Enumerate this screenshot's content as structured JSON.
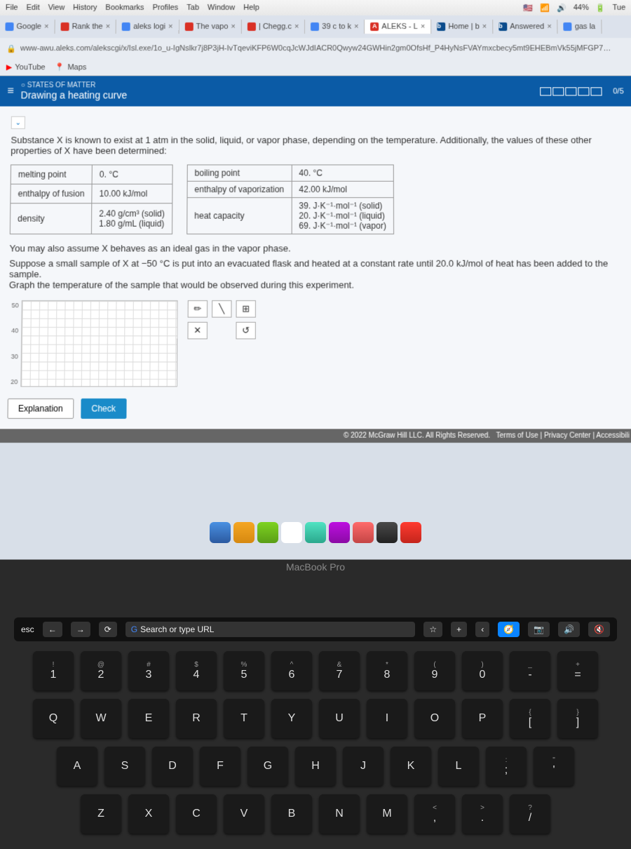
{
  "menubar": {
    "items": [
      "File",
      "Edit",
      "View",
      "History",
      "Bookmarks",
      "Profiles",
      "Tab",
      "Window",
      "Help"
    ],
    "battery": "44%",
    "day": "Tue"
  },
  "tabs": [
    {
      "label": "Google",
      "icon": "#4285f4"
    },
    {
      "label": "Rank the",
      "icon": "#d93025"
    },
    {
      "label": "aleks logi",
      "icon": "#4285f4"
    },
    {
      "label": "The vapo",
      "icon": "#d93025"
    },
    {
      "label": "| Chegg.c",
      "icon": "#d93025"
    },
    {
      "label": "39 c to k",
      "icon": "#4285f4"
    },
    {
      "label": "ALEKS - L",
      "icon": "#d93025",
      "active": true
    },
    {
      "label": "Home | b",
      "icon": "#0a4b8c"
    },
    {
      "label": "Answered",
      "icon": "#0a4b8c"
    },
    {
      "label": "gas la",
      "icon": "#4285f4"
    }
  ],
  "url": "www-awu.aleks.com/alekscgi/x/Isl.exe/1o_u-IgNslkr7j8P3jH-IvTqeviKFP6W0cqJcWJdIACR0Qwyw24GWHin2gm0OfsHf_P4HyNsFVAYmxcbecy5mt9EHEBmVk55jMFGP7…",
  "bookmarks": [
    {
      "label": "YouTube",
      "icon": "#ff0000"
    },
    {
      "label": "Maps",
      "icon": "#34a853"
    }
  ],
  "aleks": {
    "category": "STATES OF MATTER",
    "title": "Drawing a heating curve",
    "score": "0/5"
  },
  "problem": {
    "intro": "Substance X is known to exist at 1 atm in the solid, liquid, or vapor phase, depending on the temperature. Additionally, the values of these other properties of X have been determined:",
    "table1": {
      "r1c1": "melting point",
      "r1c2": "0. °C",
      "r2c1": "enthalpy of fusion",
      "r2c2": "10.00 kJ/mol",
      "r3c1": "density",
      "r3c2a": "2.40 g/cm³ (solid)",
      "r3c2b": "1.80 g/mL (liquid)"
    },
    "table2": {
      "r1c1": "boiling point",
      "r1c2": "40. °C",
      "r2c1": "enthalpy of vaporization",
      "r2c2": "42.00 kJ/mol",
      "r3c1": "heat capacity",
      "r3c2a": "39. J·K⁻¹·mol⁻¹ (solid)",
      "r3c2b": "20. J·K⁻¹·mol⁻¹ (liquid)",
      "r3c2c": "69. J·K⁻¹·mol⁻¹ (vapor)"
    },
    "assume": "You may also assume X behaves as an ideal gas in the vapor phase.",
    "task1": "Suppose a small sample of X at −50 °C is put into an evacuated flask and heated at a constant rate until 20.0 kJ/mol of heat has been added to the sample.",
    "task2": "Graph the temperature of the sample that would be observed during this experiment."
  },
  "graph": {
    "yticks": [
      "50",
      "40",
      "30",
      "20"
    ]
  },
  "buttons": {
    "explanation": "Explanation",
    "check": "Check"
  },
  "footer": {
    "copyright": "© 2022 McGraw Hill LLC. All Rights Reserved.",
    "terms": "Terms of Use",
    "privacy": "Privacy Center",
    "access": "Accessibili"
  },
  "touchbar": {
    "esc": "esc",
    "search": "Search or type URL"
  },
  "keys": {
    "row1": [
      {
        "s": "!",
        "m": "1"
      },
      {
        "s": "@",
        "m": "2"
      },
      {
        "s": "#",
        "m": "3"
      },
      {
        "s": "$",
        "m": "4"
      },
      {
        "s": "%",
        "m": "5"
      },
      {
        "s": "^",
        "m": "6"
      },
      {
        "s": "&",
        "m": "7"
      },
      {
        "s": "*",
        "m": "8"
      },
      {
        "s": "(",
        "m": "9"
      },
      {
        "s": ")",
        "m": "0"
      },
      {
        "s": "_",
        "m": "-"
      },
      {
        "s": "+",
        "m": "="
      }
    ],
    "row2": [
      "Q",
      "W",
      "E",
      "R",
      "T",
      "Y",
      "U",
      "I",
      "O",
      "P"
    ],
    "row2b": [
      {
        "s": "{",
        "m": "["
      },
      {
        "s": "}",
        "m": "]"
      }
    ],
    "row3": [
      "A",
      "S",
      "D",
      "F",
      "G",
      "H",
      "J",
      "K",
      "L"
    ],
    "row3b": [
      {
        "s": ":",
        "m": ";"
      },
      {
        "s": "\"",
        "m": "'"
      }
    ],
    "row4": [
      "Z",
      "X",
      "C",
      "V",
      "B",
      "N",
      "M"
    ],
    "row4b": [
      {
        "s": "<",
        "m": ","
      },
      {
        "s": ">",
        "m": "."
      },
      {
        "s": "?",
        "m": "/"
      }
    ]
  },
  "macbook": "MacBook Pro"
}
